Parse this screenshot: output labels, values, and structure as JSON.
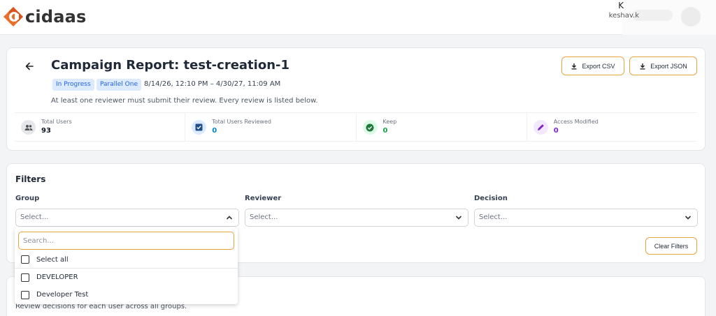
{
  "header": {
    "brand": "cidaas",
    "user_initial": "K",
    "user_email": "keshav.k"
  },
  "report": {
    "title": "Campaign Report: test-creation-1",
    "status_badge": "In Progress",
    "mode_badge": "Parallel One",
    "date_range": "8/14/26, 12:10 PM – 4/30/27, 11:09 AM",
    "description": "At least one reviewer must submit their review. Every review is listed below.",
    "export_csv_label": "Export CSV",
    "export_json_label": "Export JSON",
    "stats": [
      {
        "label": "Total Users",
        "value": "93",
        "color": "#111827",
        "icon": "users-icon"
      },
      {
        "label": "Total Users Reviewed",
        "value": "0",
        "color": "#0284c7",
        "icon": "checkbox-icon"
      },
      {
        "label": "Keep",
        "value": "0",
        "color": "#16a34a",
        "icon": "check-circle-icon"
      },
      {
        "label": "Access Modified",
        "value": "0",
        "color": "#7e22ce",
        "icon": "pencil-icon"
      }
    ]
  },
  "filters": {
    "title": "Filters",
    "group_label": "Group",
    "group_value": "Select...",
    "reviewer_label": "Reviewer",
    "reviewer_value": "Select...",
    "decision_label": "Decision",
    "decision_value": "Select...",
    "clear_label": "Clear Filters"
  },
  "group_dropdown": {
    "search_placeholder": "Search...",
    "select_all_label": "Select all",
    "options": [
      "DEVELOPER",
      "Developer Test"
    ]
  },
  "table_section": {
    "description": "Review decisions for each user across all groups."
  },
  "colors": {
    "accent": "#e8a33d",
    "badge_bg": "#dbeafe",
    "badge_text": "#2563eb"
  }
}
